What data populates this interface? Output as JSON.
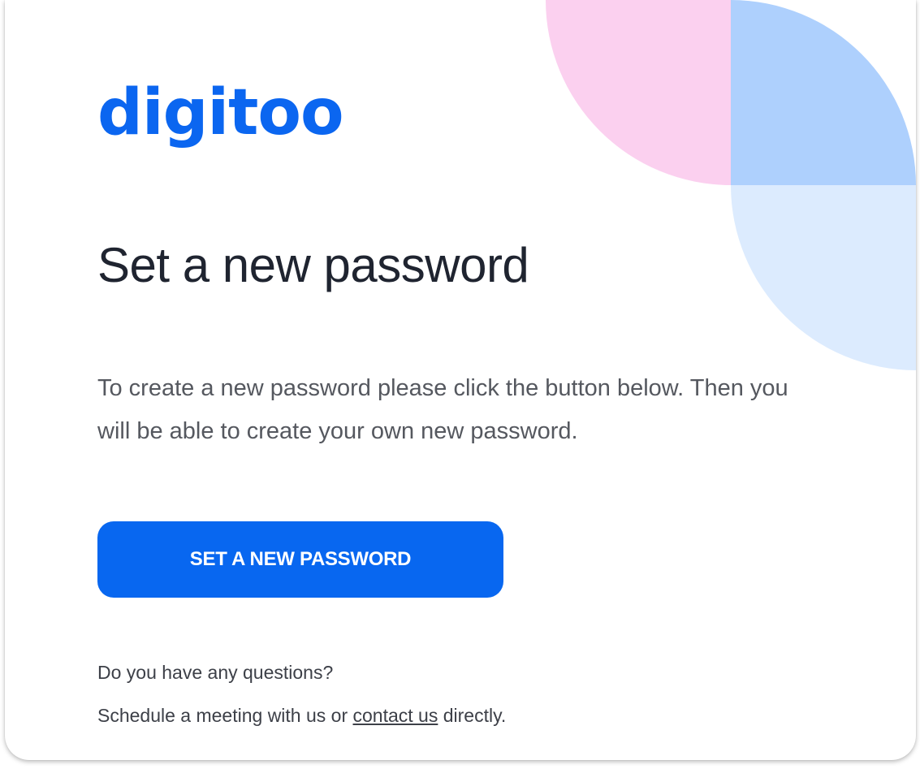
{
  "brand": {
    "logo_text": "digitoo",
    "accent_color": "#0b66f0"
  },
  "main": {
    "title": "Set a new password",
    "description": "To create a new password please click the button below. Then you will be able to create your own new password.",
    "button_label": "SET A NEW PASSWORD"
  },
  "footer": {
    "questions": "Do you have any questions?",
    "schedule_prefix": "Schedule a meeting with us or",
    "contact_link": "contact us",
    "schedule_suffix": "directly."
  },
  "decoration": {
    "pink": "#fbd0ef",
    "blue": "#aed0fd",
    "light_blue": "#dcebfe"
  }
}
